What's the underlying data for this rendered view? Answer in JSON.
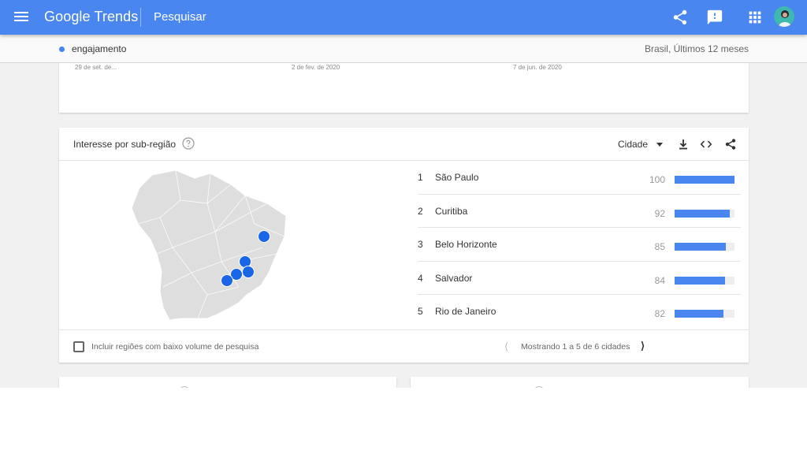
{
  "app": {
    "logo_text": "Google Trends",
    "page_title": "Pesquisar"
  },
  "subheader": {
    "term": "engajamento",
    "term_color": "#4285f4",
    "region_period": "Brasil, Últimos 12 meses"
  },
  "chart_axis": {
    "dates": [
      "29 de set. de...",
      "2 de fev. de 2020",
      "7 de jun. de 2020"
    ]
  },
  "subregion": {
    "title": "Interesse por sub-região",
    "resolution": "Cidade",
    "bar_color": "#4a86f0",
    "rows": [
      {
        "rank": "1",
        "name": "São Paulo",
        "value": "100",
        "fill": 1.0
      },
      {
        "rank": "2",
        "name": "Curitiba",
        "value": "92",
        "fill": 0.92
      },
      {
        "rank": "3",
        "name": "Belo Horizonte",
        "value": "85",
        "fill": 0.85
      },
      {
        "rank": "4",
        "name": "Salvador",
        "value": "84",
        "fill": 0.84
      },
      {
        "rank": "5",
        "name": "Rio de Janeiro",
        "value": "82",
        "fill": 0.82
      }
    ],
    "include_low_volume_label": "Incluir regiões com baixo volume de pesquisa",
    "pagination_label": "Mostrando 1 a 5 de 6 cidades"
  },
  "icons": {
    "menu": "menu-icon",
    "share": "share-icon",
    "feedback": "feedback-icon",
    "apps": "apps-grid-icon",
    "help": "help-icon",
    "download": "download-icon",
    "embed": "embed-code-icon",
    "chevron_left": "chevron-left-icon",
    "chevron_right": "chevron-right-icon"
  }
}
